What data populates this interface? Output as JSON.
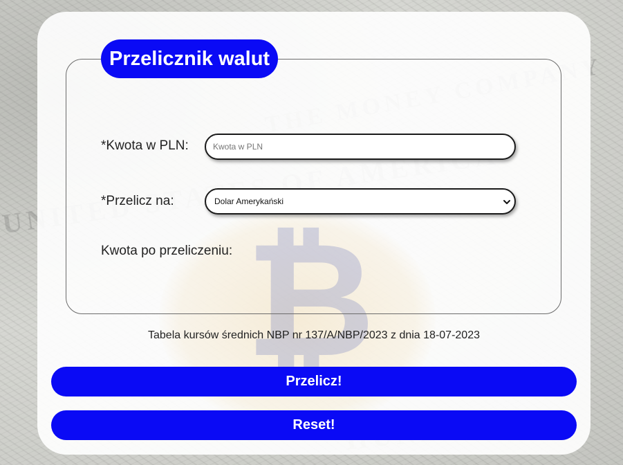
{
  "form": {
    "legend": "Przelicznik walut",
    "amount_label": "*Kwota w PLN:",
    "amount_placeholder": "Kwota w PLN",
    "amount_value": "",
    "currency_label": "*Przelicz na:",
    "currency_selected": "Dolar Amerykański",
    "result_label": "Kwota po przeliczeniu:",
    "result_value": ""
  },
  "rate_table_info": "Tabela kursów średnich NBP nr 137/A/NBP/2023 z dnia 18-07-2023",
  "buttons": {
    "convert": "Przelicz!",
    "reset": "Reset!"
  },
  "colors": {
    "accent": "#0a0af5",
    "card_background": "#ffffff",
    "text": "#222222"
  },
  "icons": {
    "select_arrow": "chevron-down-icon"
  }
}
